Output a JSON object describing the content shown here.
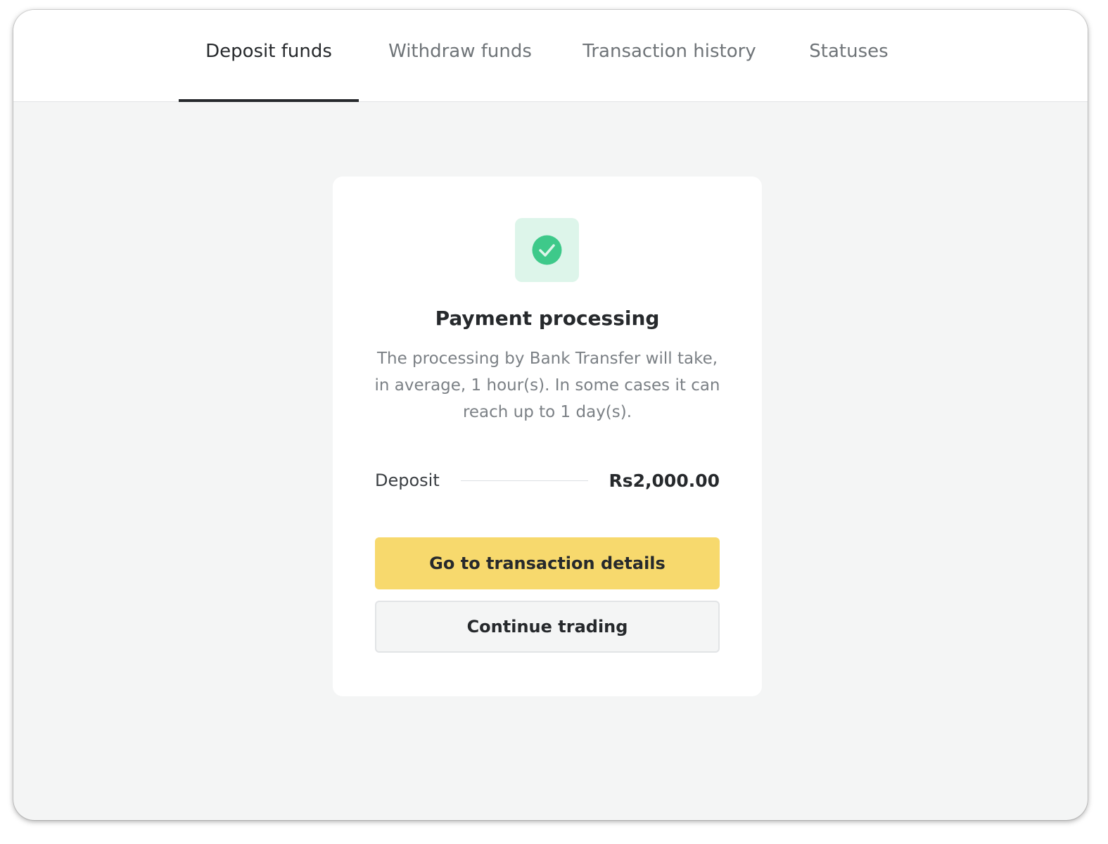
{
  "tabs": [
    {
      "label": "Deposit funds",
      "active": true
    },
    {
      "label": "Withdraw funds",
      "active": false
    },
    {
      "label": "Transaction history",
      "active": false
    },
    {
      "label": "Statuses",
      "active": false
    }
  ],
  "status": {
    "icon": "check-circle-icon",
    "icon_color": "#3ec98a",
    "title": "Payment processing",
    "description": "The processing by Bank Transfer will take, in average, 1 hour(s). In some cases it can reach up to 1 day(s)."
  },
  "deposit": {
    "label": "Deposit",
    "amount": "Rs2,000.00"
  },
  "buttons": {
    "primary_label": "Go to transaction details",
    "secondary_label": "Continue trading"
  },
  "colors": {
    "primary_button": "#f7d96d",
    "background": "#f4f5f5"
  }
}
